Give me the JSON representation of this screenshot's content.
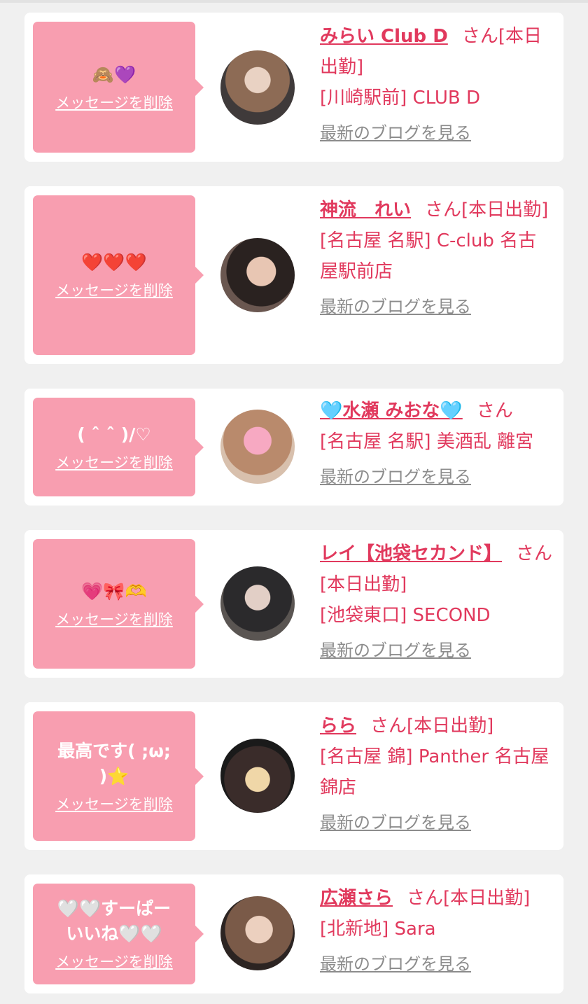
{
  "colors": {
    "accent": "#e1395d",
    "bubble": "#f89eb0",
    "link_gray": "#8c8c8c",
    "background": "#f0f0f0"
  },
  "cards": [
    {
      "message": "🙈💜",
      "delete_label": "メッセージを削除",
      "name": "みらい Club D",
      "suffix": "さん[本日出勤]",
      "shop": "[川崎駅前] CLUB D",
      "blog_label": "最新のブログを見る"
    },
    {
      "message": "❤️❤️❤️",
      "delete_label": "メッセージを削除",
      "name": "神流　れい",
      "suffix": "さん[本日出勤]",
      "shop": "[名古屋 名駅] C-club 名古屋駅前店",
      "blog_label": "最新のブログを見る"
    },
    {
      "message": "( ˆ ˆ )/♡",
      "delete_label": "メッセージを削除",
      "name": "🩵水瀬 みおな🩵",
      "suffix": "さん",
      "shop": "[名古屋 名駅] 美酒乱 離宮",
      "blog_label": "最新のブログを見る"
    },
    {
      "message": "💗🎀🫶",
      "delete_label": "メッセージを削除",
      "name": "レイ【池袋セカンド】",
      "suffix": "さん[本日出勤]",
      "shop": "[池袋東口] SECOND",
      "blog_label": "最新のブログを見る"
    },
    {
      "message": "最高です( ;ω; )⭐",
      "delete_label": "メッセージを削除",
      "name": "らら",
      "suffix": "さん[本日出勤]",
      "shop": "[名古屋 錦] Panther 名古屋錦店",
      "blog_label": "最新のブログを見る"
    },
    {
      "message": "🤍🤍すーぱーいいね🤍🤍",
      "delete_label": "メッセージを削除",
      "name": "広瀬さら",
      "suffix": "さん[本日出勤]",
      "shop": "[北新地] Sara",
      "blog_label": "最新のブログを見る"
    }
  ]
}
